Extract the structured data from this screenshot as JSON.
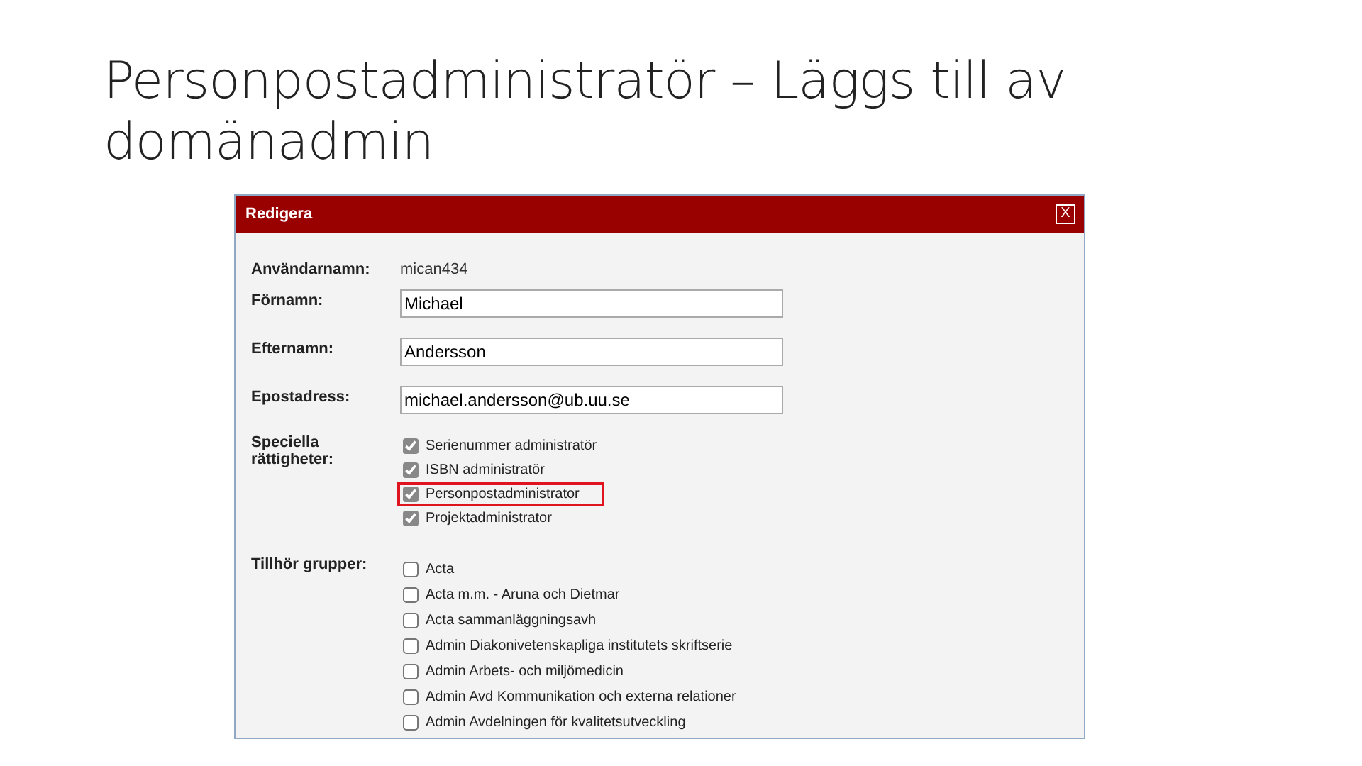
{
  "slide_title": "Personpostadministratör – Läggs till av domänadmin",
  "dialog": {
    "title": "Redigera",
    "close": "X",
    "username": {
      "label": "Användarnamn:",
      "value": "mican434"
    },
    "fields": [
      {
        "label": "Förnamn:",
        "value": "Michael"
      },
      {
        "label": "Efternamn:",
        "value": "Andersson"
      },
      {
        "label": "Epostadress:",
        "value": "michael.andersson@ub.uu.se"
      }
    ],
    "rights": {
      "label": "Speciella rättigheter:",
      "items": [
        {
          "label": "Serienummer administratör",
          "checked": true,
          "highlighted": false
        },
        {
          "label": "ISBN administratör",
          "checked": true,
          "highlighted": false
        },
        {
          "label": "Personpostadministrator",
          "checked": true,
          "highlighted": true
        },
        {
          "label": "Projektadministrator",
          "checked": true,
          "highlighted": false
        }
      ]
    },
    "groups": {
      "label": "Tillhör grupper:",
      "items": [
        {
          "label": "Acta",
          "checked": false
        },
        {
          "label": "Acta m.m. - Aruna och Dietmar",
          "checked": false
        },
        {
          "label": "Acta sammanläggningsavh",
          "checked": false
        },
        {
          "label": "Admin Diakonivetenskapliga institutets skriftserie",
          "checked": false
        },
        {
          "label": "Admin Arbets- och miljömedicin",
          "checked": false
        },
        {
          "label": "Admin Avd Kommunikation och externa relationer",
          "checked": false
        },
        {
          "label": "Admin Avdelningen för kvalitetsutveckling",
          "checked": false
        }
      ]
    }
  }
}
